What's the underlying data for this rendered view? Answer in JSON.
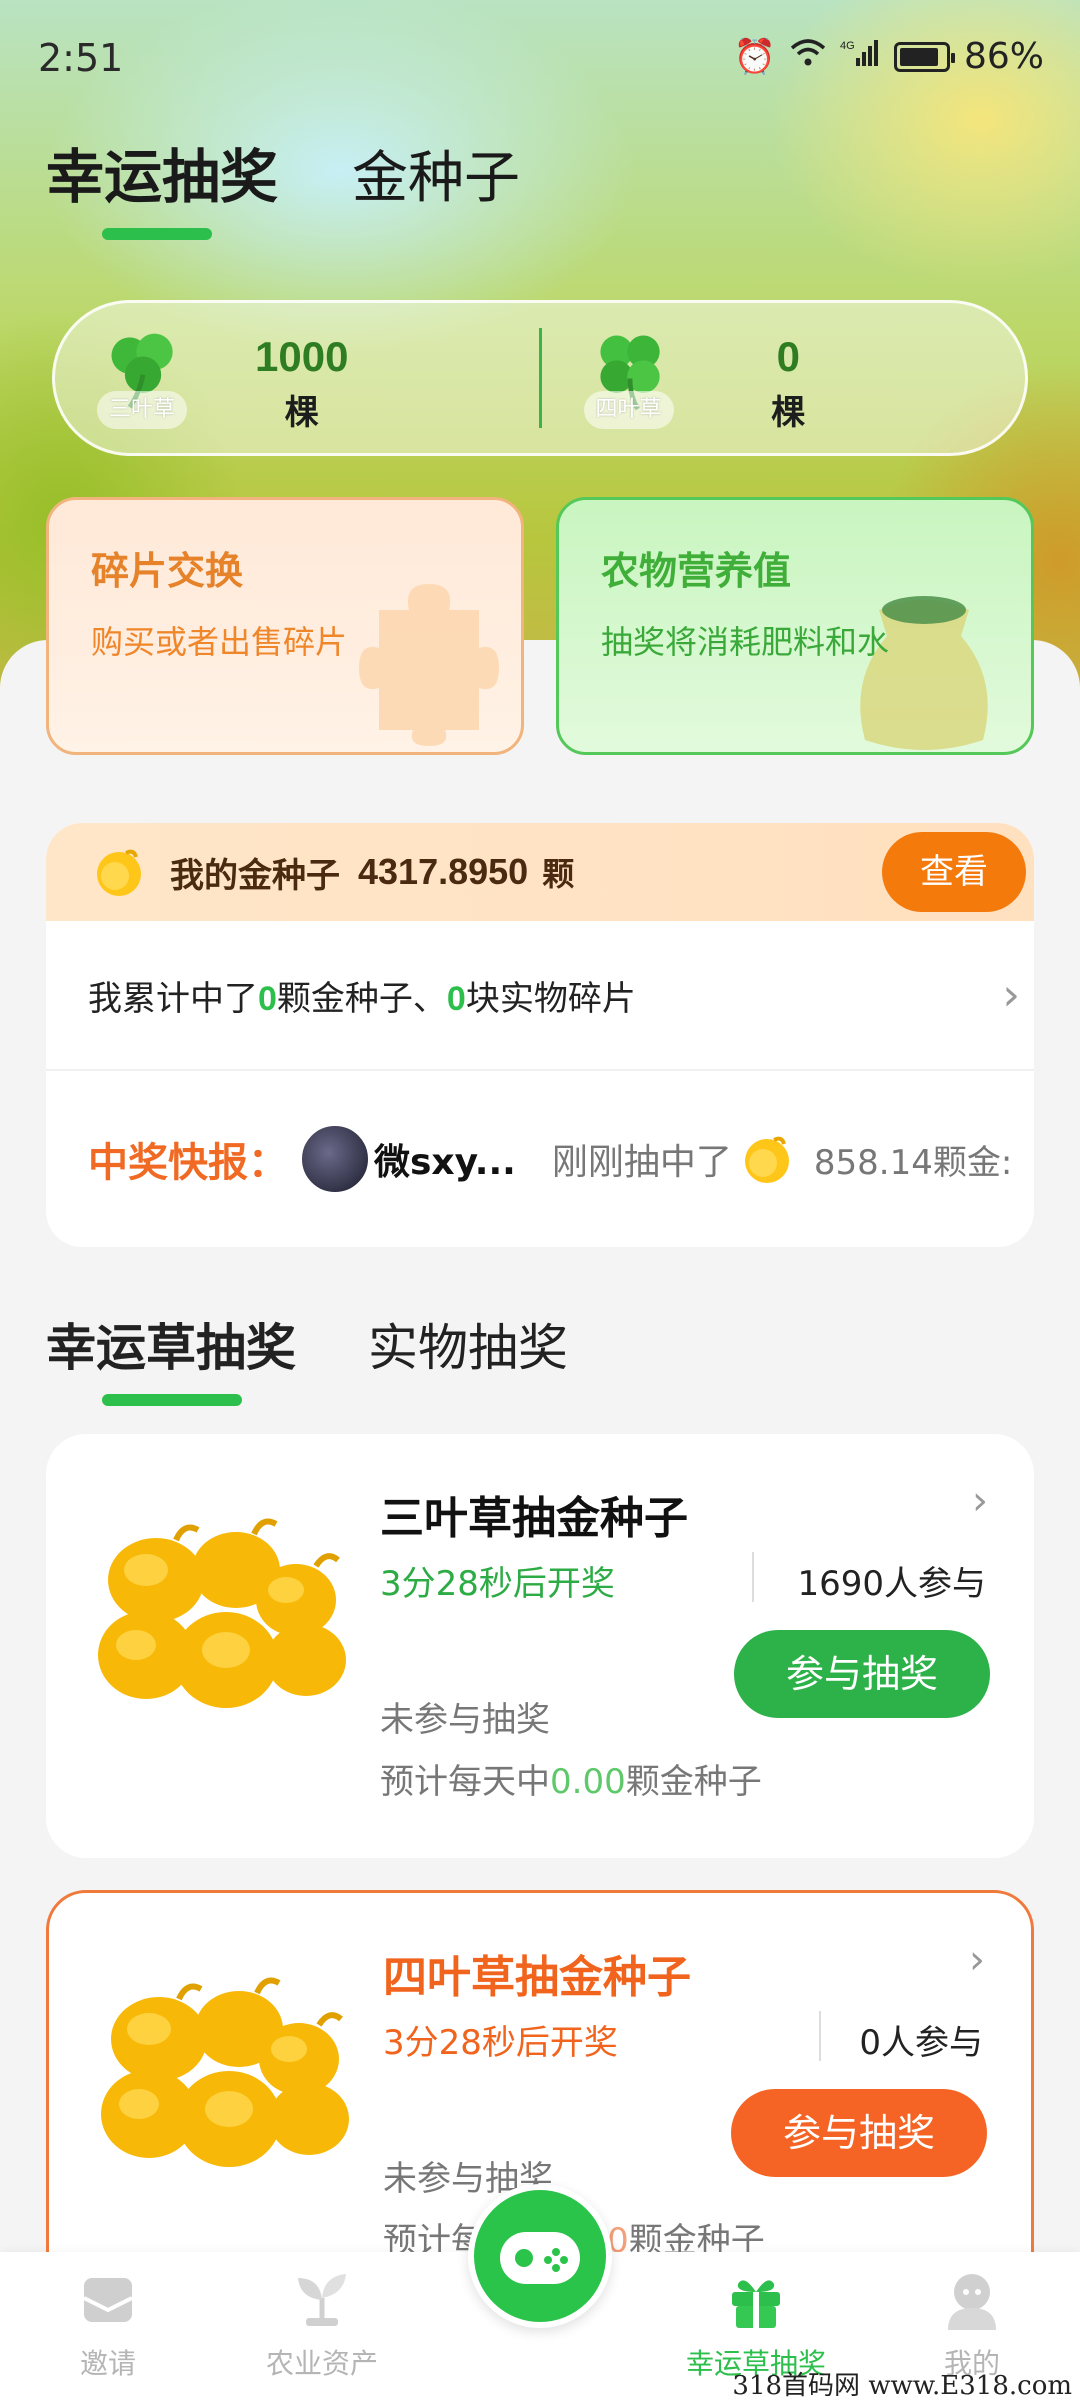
{
  "status_bar": {
    "time": "2:51",
    "network": "4G",
    "battery": "86%"
  },
  "top_tabs": [
    {
      "label": "幸运抽奖",
      "active": true
    },
    {
      "label": "金种子",
      "active": false
    }
  ],
  "clovers": {
    "three_leaf": {
      "tag": "三叶草",
      "count": "1000",
      "unit": "棵"
    },
    "four_leaf": {
      "tag": "四叶草",
      "count": "0",
      "unit": "棵"
    }
  },
  "feature_cards": {
    "fragment": {
      "title": "碎片交换",
      "subtitle": "购买或者出售碎片"
    },
    "nutrition": {
      "title": "农物营养值",
      "subtitle": "抽奖将消耗肥料和水"
    }
  },
  "seed_panel": {
    "label": "我的金种子",
    "value": "4317.8950",
    "unit": "颗",
    "view_button": "查看",
    "stats": {
      "prefix": "我累计中了",
      "seeds_won": "0",
      "middle": "颗金种子、",
      "fragments_won": "0",
      "suffix": "块实物碎片"
    },
    "news": {
      "label": "中奖快报：",
      "user": "微sxy...",
      "action": "刚刚抽中了",
      "amount": "858.14颗金:"
    }
  },
  "lottery_tabs": [
    {
      "label": "幸运草抽奖",
      "active": true
    },
    {
      "label": "实物抽奖",
      "active": false
    }
  ],
  "lotteries": [
    {
      "title": "三叶草抽金种子",
      "countdown": "3分28秒后开奖",
      "participants": "1690人参与",
      "button": "参与抽奖",
      "status": "未参与抽奖",
      "estimate_prefix": "预计每天中",
      "estimate_value": "0.00",
      "estimate_suffix": "颗金种子"
    },
    {
      "title": "四叶草抽金种子",
      "countdown": "3分28秒后开奖",
      "participants": "0人参与",
      "button": "参与抽奖",
      "status": "未参与抽奖",
      "estimate_prefix": "预计每天中",
      "estimate_value": "0.00",
      "estimate_suffix": "颗金种子"
    }
  ],
  "bottom_nav": [
    {
      "label": "邀请",
      "icon": "invite-icon"
    },
    {
      "label": "农业资产",
      "icon": "plant-icon"
    },
    {
      "label": "",
      "icon": "gamepad-icon"
    },
    {
      "label": "幸运草抽奖",
      "icon": "gift-icon",
      "active": true
    },
    {
      "label": "我的",
      "icon": "profile-icon"
    }
  ],
  "watermark": "318首码网 www.E318.com",
  "colors": {
    "accent_green": "#2dbf4b",
    "accent_orange": "#f47a0c",
    "danger_orange": "#f0641e"
  }
}
